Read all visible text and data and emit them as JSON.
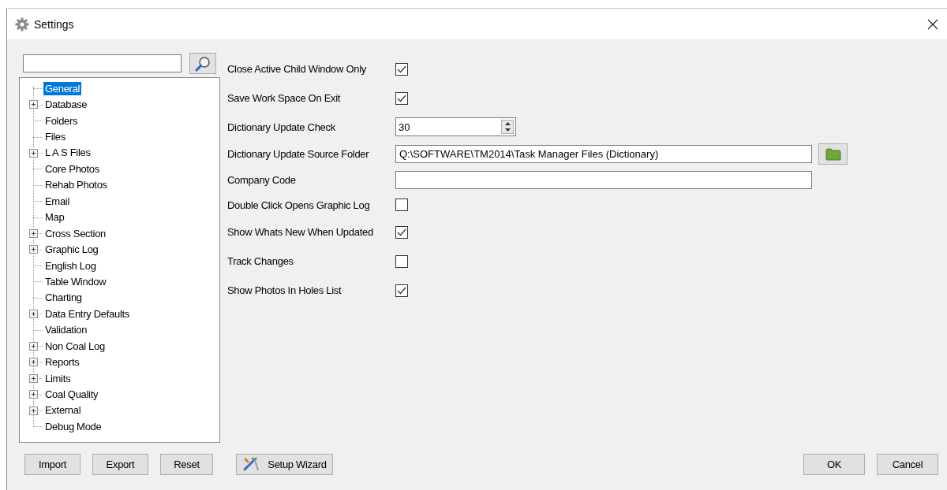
{
  "window": {
    "title": "Settings"
  },
  "tree": [
    {
      "label": "General",
      "kind": "leaf",
      "selected": true
    },
    {
      "label": "Database",
      "kind": "group",
      "selected": false
    },
    {
      "label": "Folders",
      "kind": "leaf",
      "selected": false
    },
    {
      "label": "Files",
      "kind": "leaf",
      "selected": false
    },
    {
      "label": "L A S Files",
      "kind": "group",
      "selected": false
    },
    {
      "label": "Core Photos",
      "kind": "leaf",
      "selected": false
    },
    {
      "label": "Rehab Photos",
      "kind": "leaf",
      "selected": false
    },
    {
      "label": "Email",
      "kind": "leaf",
      "selected": false
    },
    {
      "label": "Map",
      "kind": "leaf",
      "selected": false
    },
    {
      "label": "Cross Section",
      "kind": "group",
      "selected": false
    },
    {
      "label": "Graphic Log",
      "kind": "group",
      "selected": false
    },
    {
      "label": "English Log",
      "kind": "leaf",
      "selected": false
    },
    {
      "label": "Table Window",
      "kind": "leaf",
      "selected": false
    },
    {
      "label": "Charting",
      "kind": "leaf",
      "selected": false
    },
    {
      "label": "Data Entry Defaults",
      "kind": "group",
      "selected": false
    },
    {
      "label": "Validation",
      "kind": "leaf",
      "selected": false
    },
    {
      "label": "Non Coal Log",
      "kind": "group",
      "selected": false
    },
    {
      "label": "Reports",
      "kind": "group",
      "selected": false
    },
    {
      "label": "Limits",
      "kind": "group",
      "selected": false
    },
    {
      "label": "Coal Quality",
      "kind": "group",
      "selected": false
    },
    {
      "label": "External",
      "kind": "group",
      "selected": false
    },
    {
      "label": "Debug Mode",
      "kind": "leaf",
      "selected": false
    }
  ],
  "settings": [
    {
      "label": "Close Active Child Window Only",
      "kind": "checkbox",
      "checked": true
    },
    {
      "label": "Save Work Space On Exit",
      "kind": "checkbox",
      "checked": true
    },
    {
      "label": "Dictionary Update Check",
      "kind": "spinner",
      "value": "30"
    },
    {
      "label": "Dictionary Update Source Folder",
      "kind": "folder",
      "value": "Q:\\SOFTWARE\\TM2014\\Task Manager Files (Dictionary)"
    },
    {
      "label": "Company Code",
      "kind": "text"
    },
    {
      "label": "Double Click Opens Graphic Log",
      "kind": "checkbox",
      "checked": false
    },
    {
      "label": "Show Whats New When Updated",
      "kind": "checkbox",
      "checked": true
    },
    {
      "label": "Track Changes",
      "kind": "checkbox",
      "checked": false
    },
    {
      "label": "Show Photos In Holes List",
      "kind": "checkbox",
      "checked": true
    }
  ],
  "left_buttons": [
    "Import",
    "Export",
    "Reset"
  ],
  "wizard_button": "Setup Wizard",
  "right_buttons": [
    "OK",
    "Cancel"
  ]
}
